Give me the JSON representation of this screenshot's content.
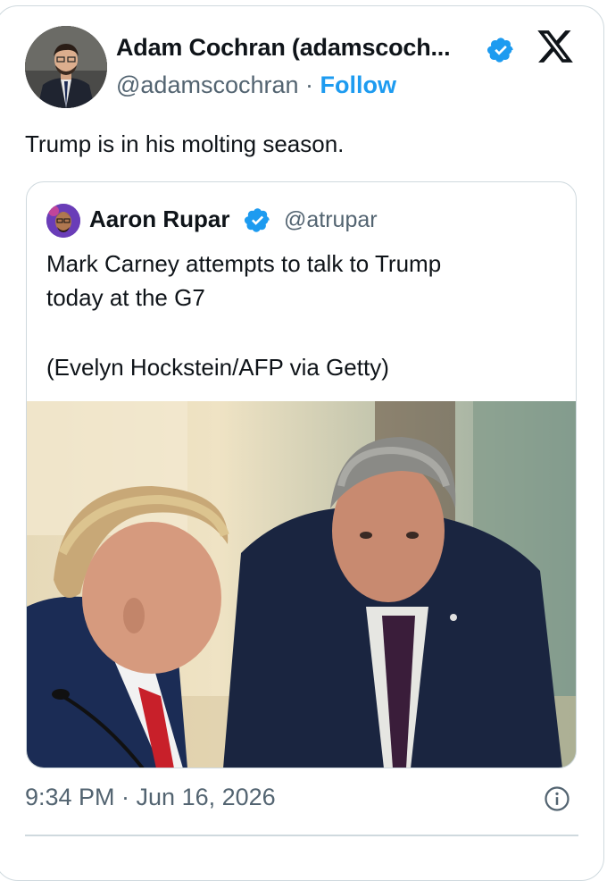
{
  "author": {
    "name": "Adam Cochran (adamscoch...",
    "handle": "@adamscochran",
    "separator": "·",
    "follow_label": "Follow"
  },
  "tweet": {
    "text": "Trump is in his molting season."
  },
  "quoted": {
    "name": "Aaron Rupar",
    "handle": "@atrupar",
    "lines": [
      "Mark Carney attempts to talk to Trump",
      "today at the G7",
      "(Evelyn Hockstein/AFP via Getty)"
    ]
  },
  "timestamp": "9:34 PM · Jun 16, 2026",
  "colors": {
    "accent": "#1d9bf0",
    "text": "#0f1419",
    "secondary": "#536471",
    "border": "#cfd9de"
  },
  "icons": [
    "verified-badge-icon",
    "x-logo-icon",
    "info-icon"
  ]
}
